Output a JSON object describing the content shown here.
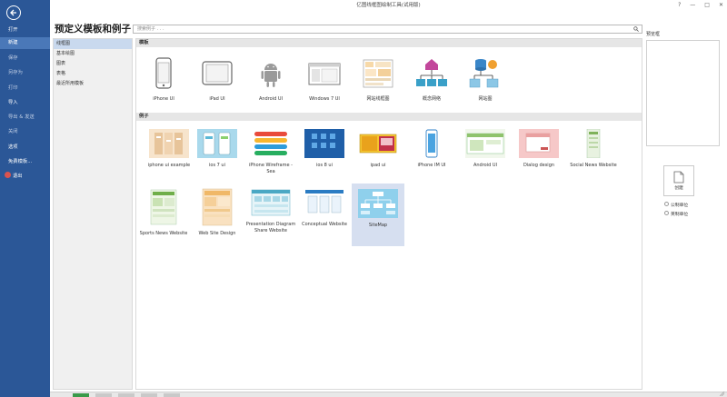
{
  "window": {
    "title": "亿图线框图绘制工具(试用版)",
    "controls": {
      "help": "?",
      "minimize": "—",
      "maximize": "□",
      "close": "✕"
    }
  },
  "sidebar": {
    "items": [
      {
        "label": "打开",
        "state": "normal"
      },
      {
        "label": "新建",
        "state": "active"
      },
      {
        "label": "保存",
        "state": "dim"
      },
      {
        "label": "另存为",
        "state": "dim"
      },
      {
        "label": "打印",
        "state": "dim"
      },
      {
        "label": "导入",
        "state": "normal"
      },
      {
        "label": "导出 & 发送",
        "state": "dim"
      },
      {
        "label": "关闭",
        "state": "dim"
      },
      {
        "label": "选项",
        "state": "normal"
      },
      {
        "label": "免费模板...",
        "state": "normal"
      },
      {
        "label": "退出",
        "state": "normal"
      }
    ]
  },
  "page_title": "预定义模板和例子",
  "search": {
    "placeholder": "搜索例子 . . ."
  },
  "categories": [
    "线框图",
    "基本绘图",
    "图表",
    "表格",
    "最近所用模板"
  ],
  "templates_section": {
    "title": "模板",
    "items": [
      "iPhone UI",
      "iPad UI",
      "Android UI",
      "Windows 7 UI",
      "网站线框图",
      "概念网络",
      "网站图"
    ]
  },
  "examples_section": {
    "title": "例子",
    "items": [
      "iphone ui example",
      "ios 7 ui",
      "iPhone Wireframe - Sea",
      "ios 8 ui",
      "ipad ui",
      "iPhone IM UI",
      "Android UI",
      "Dialog design",
      "Social News Website",
      "Sports News Website",
      "Web Site Design",
      "Presentation Diagram Share Website",
      "Conceptual Website",
      "SiteMap"
    ],
    "selected": "SiteMap"
  },
  "preview": {
    "title": "预览框"
  },
  "create_button": {
    "label": "创建"
  },
  "units": {
    "metric": "公制单位",
    "imperial": "英制单位"
  },
  "colors": {
    "sidebar": "#2b5797",
    "sidebar_active": "#4a78b8",
    "selected_tile": "#d6dff0",
    "category_active": "#c9d9ee"
  }
}
